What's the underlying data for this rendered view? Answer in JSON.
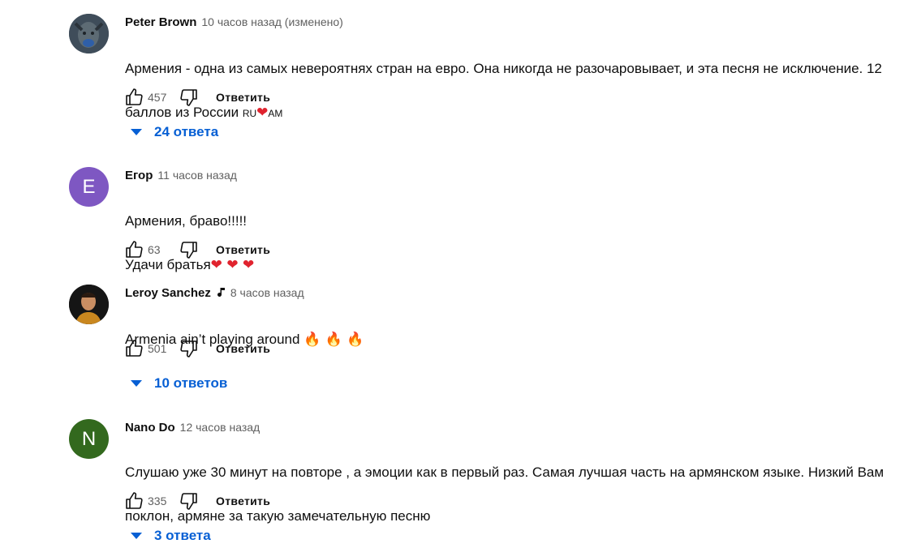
{
  "comments": [
    {
      "author": "Peter Brown",
      "time": "10 часов назад (изменено)",
      "text_main": "Армения - одна из самых невероятнях стран на евро. Она никогда не разочаровывает, и эта песня не исключение. 12",
      "text_line2": "баллов из России ",
      "flag_ru": "RU",
      "heart": "❤",
      "flag_am": "AM",
      "likes": "457",
      "reply": "Ответить",
      "replies": "24 ответа",
      "avatar_letter": ""
    },
    {
      "author": "Егор",
      "time": "11 часов назад",
      "text_line1": "Армения, браво!!!!!",
      "text_line2": "Удачи братья",
      "hearts": "❤ ❤ ❤",
      "likes": "63",
      "reply": "Ответить",
      "avatar_letter": "E"
    },
    {
      "author": "Leroy Sanchez",
      "time": "8 часов назад",
      "text_line1": "Armenia ain’t playing around ",
      "fires": "🔥 🔥 🔥",
      "likes": "501",
      "reply": "Ответить",
      "replies": "10 ответов",
      "avatar_letter": ""
    },
    {
      "author": "Nano Do",
      "time": "12 часов назад",
      "text_line1": "Слушаю уже 30 минут на повторе , а эмоции как в первый раз. Самая лучшая часть на армянском языке. Низкий Вам",
      "text_line2": "поклон, армяне за такую замечательную песню",
      "likes": "335",
      "reply": "Ответить",
      "replies": "3 ответа",
      "avatar_letter": "N"
    }
  ],
  "colors": {
    "link_blue": "#065fd4",
    "avatar_e": "#7e57c2",
    "avatar_n": "#33691e",
    "heart_red": "#e0232e"
  }
}
